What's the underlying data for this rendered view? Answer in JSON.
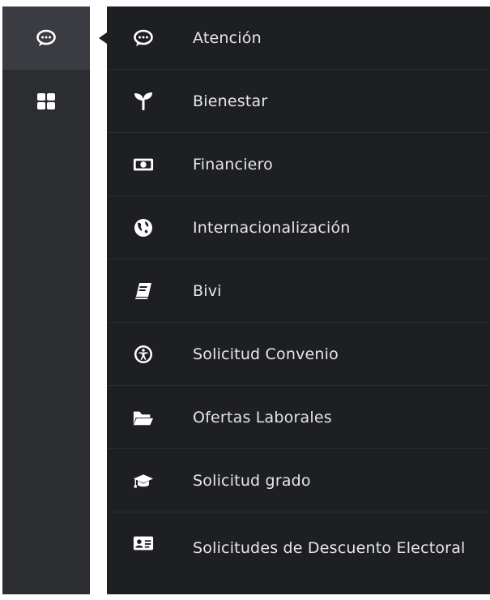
{
  "rail": {
    "items": [
      {
        "icon": "chat-icon",
        "active": true
      },
      {
        "icon": "grid-icon",
        "active": false
      }
    ]
  },
  "menu": {
    "items": [
      {
        "label": "Atención",
        "icon": "chat-icon"
      },
      {
        "label": "Bienestar",
        "icon": "seedling-icon"
      },
      {
        "label": "Financiero",
        "icon": "money-bill-icon"
      },
      {
        "label": "Internacionalización",
        "icon": "globe-icon"
      },
      {
        "label": "Bivi",
        "icon": "book-icon"
      },
      {
        "label": "Solicitud Convenio",
        "icon": "universal-access-icon"
      },
      {
        "label": "Ofertas Laborales",
        "icon": "folder-open-icon"
      },
      {
        "label": "Solicitud grado",
        "icon": "graduation-cap-icon"
      },
      {
        "label": "Solicitudes de Descuento Electoral",
        "icon": "id-card-icon"
      }
    ]
  },
  "colors": {
    "rail_bg": "#2b2d31",
    "rail_active_bg": "#3a3c41",
    "panel_bg": "#1d1f22",
    "text": "#e6e6e6",
    "icon": "#ffffff"
  }
}
